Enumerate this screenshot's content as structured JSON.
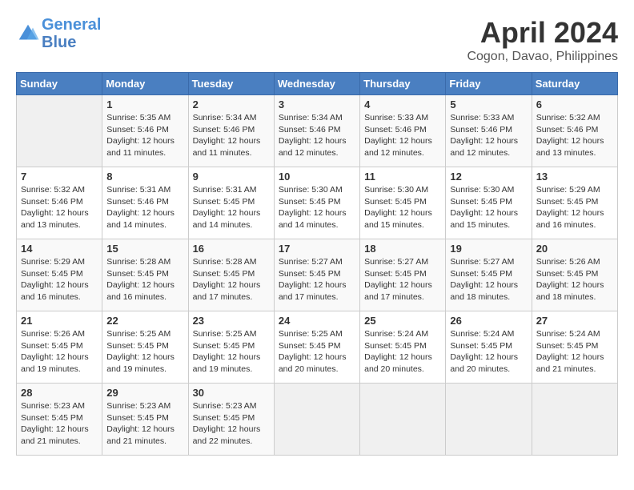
{
  "header": {
    "logo_line1": "General",
    "logo_line2": "Blue",
    "month": "April 2024",
    "location": "Cogon, Davao, Philippines"
  },
  "weekdays": [
    "Sunday",
    "Monday",
    "Tuesday",
    "Wednesday",
    "Thursday",
    "Friday",
    "Saturday"
  ],
  "weeks": [
    [
      {
        "day": "",
        "sunrise": "",
        "sunset": "",
        "daylight": ""
      },
      {
        "day": "1",
        "sunrise": "Sunrise: 5:35 AM",
        "sunset": "Sunset: 5:46 PM",
        "daylight": "Daylight: 12 hours and 11 minutes."
      },
      {
        "day": "2",
        "sunrise": "Sunrise: 5:34 AM",
        "sunset": "Sunset: 5:46 PM",
        "daylight": "Daylight: 12 hours and 11 minutes."
      },
      {
        "day": "3",
        "sunrise": "Sunrise: 5:34 AM",
        "sunset": "Sunset: 5:46 PM",
        "daylight": "Daylight: 12 hours and 12 minutes."
      },
      {
        "day": "4",
        "sunrise": "Sunrise: 5:33 AM",
        "sunset": "Sunset: 5:46 PM",
        "daylight": "Daylight: 12 hours and 12 minutes."
      },
      {
        "day": "5",
        "sunrise": "Sunrise: 5:33 AM",
        "sunset": "Sunset: 5:46 PM",
        "daylight": "Daylight: 12 hours and 12 minutes."
      },
      {
        "day": "6",
        "sunrise": "Sunrise: 5:32 AM",
        "sunset": "Sunset: 5:46 PM",
        "daylight": "Daylight: 12 hours and 13 minutes."
      }
    ],
    [
      {
        "day": "7",
        "sunrise": "Sunrise: 5:32 AM",
        "sunset": "Sunset: 5:46 PM",
        "daylight": "Daylight: 12 hours and 13 minutes."
      },
      {
        "day": "8",
        "sunrise": "Sunrise: 5:31 AM",
        "sunset": "Sunset: 5:46 PM",
        "daylight": "Daylight: 12 hours and 14 minutes."
      },
      {
        "day": "9",
        "sunrise": "Sunrise: 5:31 AM",
        "sunset": "Sunset: 5:45 PM",
        "daylight": "Daylight: 12 hours and 14 minutes."
      },
      {
        "day": "10",
        "sunrise": "Sunrise: 5:30 AM",
        "sunset": "Sunset: 5:45 PM",
        "daylight": "Daylight: 12 hours and 14 minutes."
      },
      {
        "day": "11",
        "sunrise": "Sunrise: 5:30 AM",
        "sunset": "Sunset: 5:45 PM",
        "daylight": "Daylight: 12 hours and 15 minutes."
      },
      {
        "day": "12",
        "sunrise": "Sunrise: 5:30 AM",
        "sunset": "Sunset: 5:45 PM",
        "daylight": "Daylight: 12 hours and 15 minutes."
      },
      {
        "day": "13",
        "sunrise": "Sunrise: 5:29 AM",
        "sunset": "Sunset: 5:45 PM",
        "daylight": "Daylight: 12 hours and 16 minutes."
      }
    ],
    [
      {
        "day": "14",
        "sunrise": "Sunrise: 5:29 AM",
        "sunset": "Sunset: 5:45 PM",
        "daylight": "Daylight: 12 hours and 16 minutes."
      },
      {
        "day": "15",
        "sunrise": "Sunrise: 5:28 AM",
        "sunset": "Sunset: 5:45 PM",
        "daylight": "Daylight: 12 hours and 16 minutes."
      },
      {
        "day": "16",
        "sunrise": "Sunrise: 5:28 AM",
        "sunset": "Sunset: 5:45 PM",
        "daylight": "Daylight: 12 hours and 17 minutes."
      },
      {
        "day": "17",
        "sunrise": "Sunrise: 5:27 AM",
        "sunset": "Sunset: 5:45 PM",
        "daylight": "Daylight: 12 hours and 17 minutes."
      },
      {
        "day": "18",
        "sunrise": "Sunrise: 5:27 AM",
        "sunset": "Sunset: 5:45 PM",
        "daylight": "Daylight: 12 hours and 17 minutes."
      },
      {
        "day": "19",
        "sunrise": "Sunrise: 5:27 AM",
        "sunset": "Sunset: 5:45 PM",
        "daylight": "Daylight: 12 hours and 18 minutes."
      },
      {
        "day": "20",
        "sunrise": "Sunrise: 5:26 AM",
        "sunset": "Sunset: 5:45 PM",
        "daylight": "Daylight: 12 hours and 18 minutes."
      }
    ],
    [
      {
        "day": "21",
        "sunrise": "Sunrise: 5:26 AM",
        "sunset": "Sunset: 5:45 PM",
        "daylight": "Daylight: 12 hours and 19 minutes."
      },
      {
        "day": "22",
        "sunrise": "Sunrise: 5:25 AM",
        "sunset": "Sunset: 5:45 PM",
        "daylight": "Daylight: 12 hours and 19 minutes."
      },
      {
        "day": "23",
        "sunrise": "Sunrise: 5:25 AM",
        "sunset": "Sunset: 5:45 PM",
        "daylight": "Daylight: 12 hours and 19 minutes."
      },
      {
        "day": "24",
        "sunrise": "Sunrise: 5:25 AM",
        "sunset": "Sunset: 5:45 PM",
        "daylight": "Daylight: 12 hours and 20 minutes."
      },
      {
        "day": "25",
        "sunrise": "Sunrise: 5:24 AM",
        "sunset": "Sunset: 5:45 PM",
        "daylight": "Daylight: 12 hours and 20 minutes."
      },
      {
        "day": "26",
        "sunrise": "Sunrise: 5:24 AM",
        "sunset": "Sunset: 5:45 PM",
        "daylight": "Daylight: 12 hours and 20 minutes."
      },
      {
        "day": "27",
        "sunrise": "Sunrise: 5:24 AM",
        "sunset": "Sunset: 5:45 PM",
        "daylight": "Daylight: 12 hours and 21 minutes."
      }
    ],
    [
      {
        "day": "28",
        "sunrise": "Sunrise: 5:23 AM",
        "sunset": "Sunset: 5:45 PM",
        "daylight": "Daylight: 12 hours and 21 minutes."
      },
      {
        "day": "29",
        "sunrise": "Sunrise: 5:23 AM",
        "sunset": "Sunset: 5:45 PM",
        "daylight": "Daylight: 12 hours and 21 minutes."
      },
      {
        "day": "30",
        "sunrise": "Sunrise: 5:23 AM",
        "sunset": "Sunset: 5:45 PM",
        "daylight": "Daylight: 12 hours and 22 minutes."
      },
      {
        "day": "",
        "sunrise": "",
        "sunset": "",
        "daylight": ""
      },
      {
        "day": "",
        "sunrise": "",
        "sunset": "",
        "daylight": ""
      },
      {
        "day": "",
        "sunrise": "",
        "sunset": "",
        "daylight": ""
      },
      {
        "day": "",
        "sunrise": "",
        "sunset": "",
        "daylight": ""
      }
    ]
  ]
}
